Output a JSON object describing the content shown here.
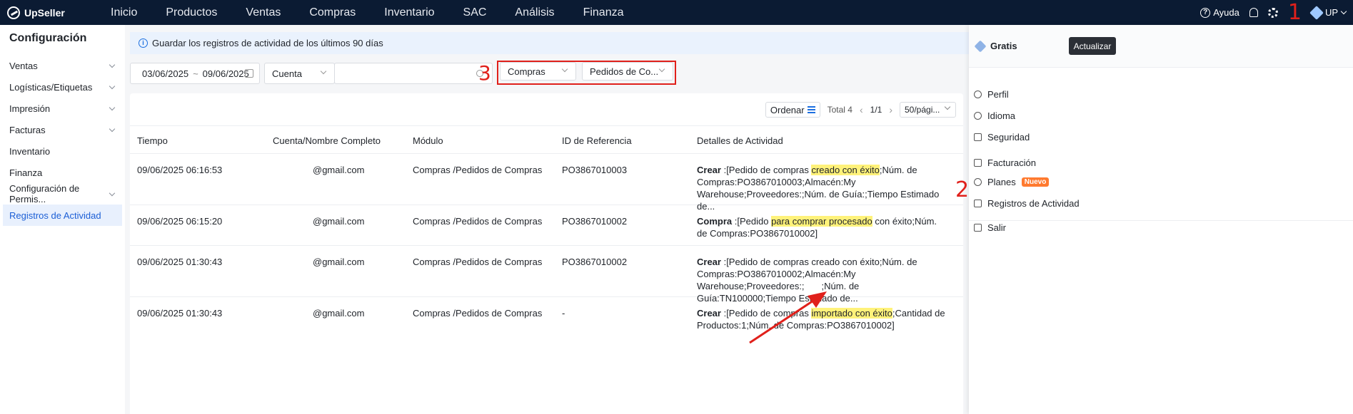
{
  "topbar": {
    "logo": "UpSeller",
    "nav": [
      "Inicio",
      "Productos",
      "Ventas",
      "Compras",
      "Inventario",
      "SAC",
      "Análisis",
      "Finanza"
    ],
    "help": "Ayuda",
    "user": "UP"
  },
  "annotations": {
    "n1": "1",
    "n2": "2",
    "n3": "3"
  },
  "sidebar": {
    "title": "Configuración",
    "items": [
      {
        "label": "Ventas"
      },
      {
        "label": "Logísticas/Etiquetas"
      },
      {
        "label": "Impresión"
      },
      {
        "label": "Facturas"
      },
      {
        "label": "Inventario"
      },
      {
        "label": "Finanza"
      },
      {
        "label": "Configuración de Permis..."
      },
      {
        "label": "Registros de Actividad"
      }
    ]
  },
  "notice": "Guardar los registros de actividad de los últimos 90 días",
  "filters": {
    "date_from": "03/06/2025",
    "date_sep": "~",
    "date_to": "09/06/2025",
    "account": "Cuenta",
    "search_value": "",
    "module": "Compras",
    "submodule": "Pedidos de Co..."
  },
  "toolbar": {
    "sort": "Ordenar",
    "total": "Total 4",
    "page": "1/1",
    "page_size": "50/pági..."
  },
  "table": {
    "headers": [
      "Tiempo",
      "Cuenta/Nombre Completo",
      "Módulo",
      "ID de Referencia",
      "Detalles de Actividad"
    ],
    "rows": [
      {
        "time": "09/06/2025 06:16:53",
        "account": "@gmail.com",
        "module": "Compras /Pedidos de Compras",
        "ref": "PO3867010003",
        "detail_action": "Crear",
        "d1": " :[Pedido de compras ",
        "d2": "creado con éxito",
        "d3": ";Núm. de Compras:PO3867010003;Almacén:My Warehouse;Proveedores:;Núm. de Guía:;Tiempo Estimado de..."
      },
      {
        "time": "09/06/2025 06:15:20",
        "account": "@gmail.com",
        "module": "Compras /Pedidos de Compras",
        "ref": "PO3867010002",
        "detail_action": "Compra",
        "d1": " :[Pedido ",
        "d2": "para comprar procesado",
        "d3": " con éxito;Núm. de Compras:PO3867010002]"
      },
      {
        "time": "09/06/2025 01:30:43",
        "account": "@gmail.com",
        "module": "Compras /Pedidos de Compras",
        "ref": "PO3867010002",
        "detail_action": "Crear",
        "d1": " :[Pedido de compras creado con éxito;Núm. de Compras:PO3867010002;Almacén:My Warehouse;Proveedores:;",
        "d2": "",
        "d3": ";Núm. de Guía:TN100000;Tiempo Estimado de..."
      },
      {
        "time": "09/06/2025 01:30:43",
        "account": "@gmail.com",
        "module": "Compras /Pedidos de Compras",
        "ref": "-",
        "detail_action": "Crear",
        "d1": " :[Pedido de compras ",
        "d2": "importado con éxito",
        "d3": ";Cantidad de Productos:1;Núm. de Compras:PO3867010002]"
      }
    ]
  },
  "user_panel": {
    "plan": "Gratis",
    "upgrade": "Actualizar",
    "items": [
      "Perfil",
      "Idioma",
      "Seguridad",
      "Facturación",
      "Planes",
      "Registros de Actividad",
      "Salir"
    ],
    "new_badge": "Nuevo"
  },
  "colors": {
    "topbar": "#0b1b33",
    "accent": "#1c5fd6",
    "annotation": "#e0201b",
    "highlight": "#fff27a"
  }
}
